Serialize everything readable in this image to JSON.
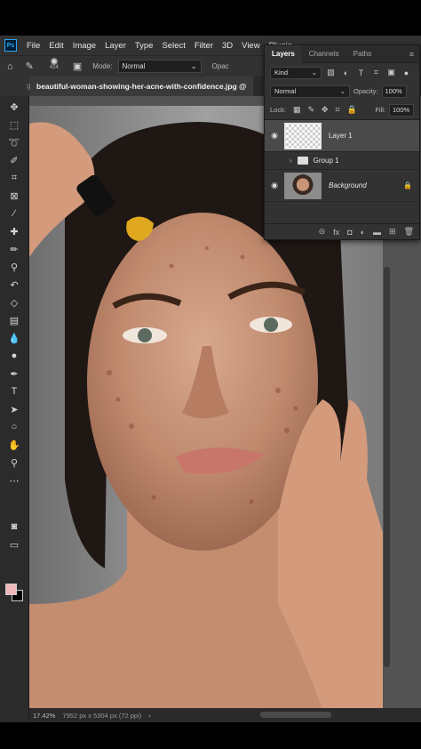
{
  "app": {
    "logo": "Ps"
  },
  "menu": [
    "File",
    "Edit",
    "Image",
    "Layer",
    "Type",
    "Select",
    "Filter",
    "3D",
    "View",
    "Plugin"
  ],
  "options": {
    "brush_size": "414",
    "mode_label": "Mode:",
    "mode_value": "Normal",
    "opacity_label": "Opac"
  },
  "document": {
    "tab_title": "beautiful-woman-showing-her-acne-with-confidence.jpg @",
    "left_fragment": "g",
    "zoom": "17.42%",
    "info": "7952 px x 5304 px (72 ppi)"
  },
  "layers_panel": {
    "tabs": [
      "Layers",
      "Channels",
      "Paths"
    ],
    "filter_kind": "Kind",
    "blend_mode": "Normal",
    "opacity_label": "Opacity:",
    "opacity_value": "100%",
    "lock_label": "Lock:",
    "fill_label": "Fill:",
    "fill_value": "100%",
    "layers": [
      {
        "name": "Layer 1"
      },
      {
        "name": "Group 1"
      },
      {
        "name": "Background"
      }
    ]
  },
  "colors": {
    "foreground": "#f0b8b8",
    "background": "#000000",
    "accent": "#2fa3f6"
  },
  "icons": [
    "home-icon",
    "brush-icon",
    "move-icon",
    "marquee-icon",
    "lasso-icon",
    "quick-select-icon",
    "crop-icon",
    "frame-icon",
    "eyedropper-icon",
    "healing-brush-icon",
    "brush-tool-icon",
    "clone-stamp-icon",
    "history-brush-icon",
    "eraser-icon",
    "gradient-icon",
    "blur-icon",
    "dodge-icon",
    "pen-icon",
    "type-icon",
    "path-select-icon",
    "shape-icon",
    "hand-icon",
    "zoom-icon",
    "more-tools-icon",
    "quick-mask-icon",
    "screen-mode-icon",
    "eye-icon",
    "lock-icon",
    "folder-icon"
  ]
}
